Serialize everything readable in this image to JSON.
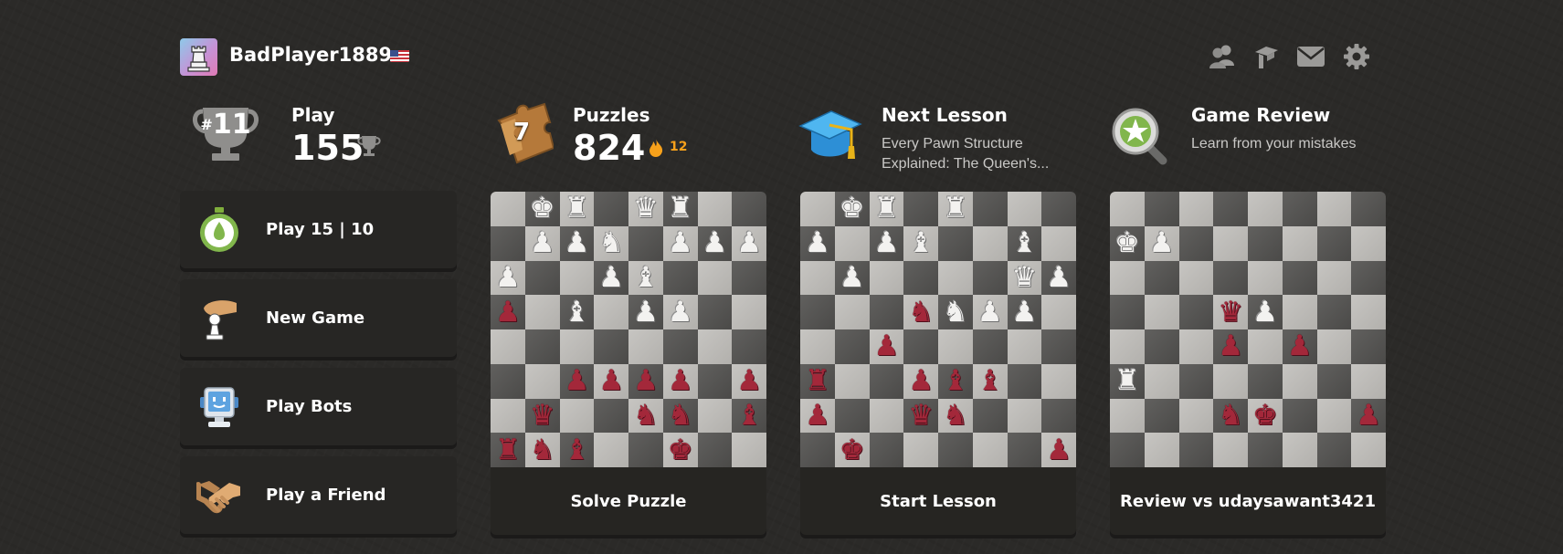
{
  "user": {
    "username": "BadPlayer1889",
    "flag": "us-flag"
  },
  "top_icons": [
    "friends-icon",
    "learn-icon",
    "messages-icon",
    "settings-icon"
  ],
  "play": {
    "title": "Play",
    "rank_badge": "#11",
    "rating": "155"
  },
  "puzzles": {
    "title": "Puzzles",
    "badge_number": "7",
    "rating": "824",
    "streak": "12"
  },
  "lesson": {
    "title": "Next Lesson",
    "subtitle_line1": "Every Pawn Structure",
    "subtitle_line2": "Explained: The Queen's..."
  },
  "review": {
    "title": "Game Review",
    "subtitle": "Learn from your mistakes"
  },
  "actions": [
    {
      "label": "Play 15 | 10",
      "icon": "stopwatch-icon"
    },
    {
      "label": "New Game",
      "icon": "hand-pawn-icon"
    },
    {
      "label": "Play Bots",
      "icon": "bot-icon"
    },
    {
      "label": "Play a Friend",
      "icon": "handshake-icon"
    }
  ],
  "cards": {
    "puzzle_footer": "Solve Puzzle",
    "lesson_footer": "Start Lesson",
    "review_footer": "Review vs udaysawant3421"
  },
  "boards": {
    "puzzle": [
      ".KR.QR..",
      ".PPN.PPP",
      "P..PB...",
      "p.B.PP..",
      "........",
      "..pppp.p",
      ".q..nn.b",
      "rnb..k.."
    ],
    "lesson": [
      ".KR.R...",
      "P.PB..B.",
      ".P....QP",
      "...nNPP.",
      "..p.....",
      "r..pbb..",
      "p..qn...",
      ".k.....p"
    ],
    "review": [
      "........",
      "KP......",
      "........",
      "...qP...",
      "...p.p..",
      "R.......",
      "...nk..p",
      "........"
    ]
  },
  "colors": {
    "accent_green": "#81b64c",
    "streak_orange": "#f7a11b",
    "dark_piece": "#a3283a"
  }
}
